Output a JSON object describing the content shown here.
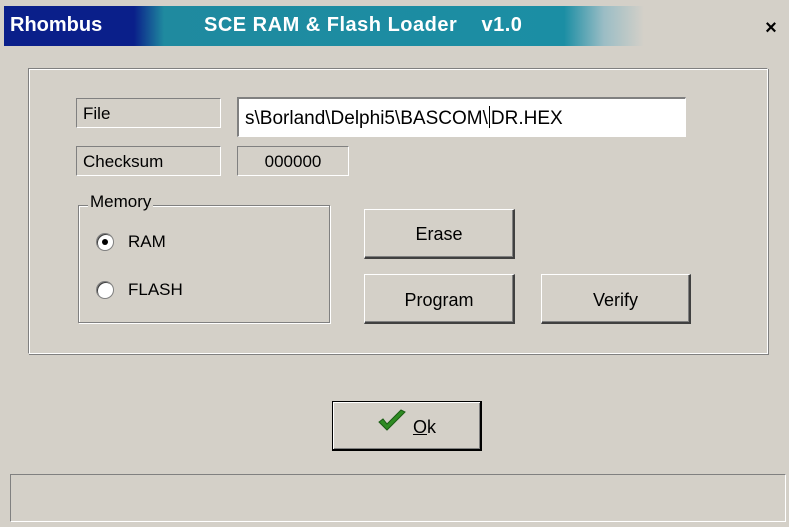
{
  "window": {
    "brand": "Rhombus",
    "title": "SCE RAM & Flash Loader    v1.0",
    "close_glyph": "×",
    "close_icon": "close-icon"
  },
  "file": {
    "label": "File",
    "value_before_caret": "s\\Borland\\Delphi5\\BASCOM\\",
    "value_after_caret": "DR.HEX"
  },
  "checksum": {
    "label": "Checksum",
    "value": "000000"
  },
  "memory": {
    "title": "Memory",
    "options": [
      {
        "label": "RAM",
        "selected": true
      },
      {
        "label": "FLASH",
        "selected": false
      }
    ]
  },
  "buttons": {
    "erase": "Erase",
    "program": "Program",
    "verify": "Verify",
    "ok_underlined": "O",
    "ok_rest": "k",
    "ok_icon": "checkmark-icon",
    "ok_icon_color": "#2e8b22"
  },
  "status": {
    "text": ""
  }
}
